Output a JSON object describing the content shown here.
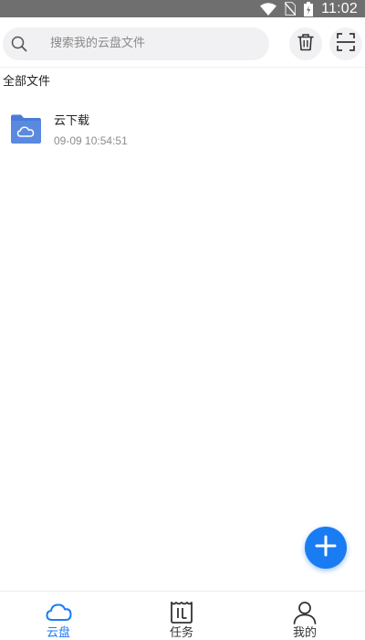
{
  "status_bar": {
    "time": "11:02",
    "icons": [
      "wifi-icon",
      "no-sim-icon",
      "battery-charging-icon"
    ]
  },
  "search": {
    "placeholder": "搜索我的云盘文件",
    "icon": "search-icon"
  },
  "toolbar": {
    "trash_icon": "trash-icon",
    "scan_icon": "scan-icon"
  },
  "breadcrumb": {
    "label": "全部文件"
  },
  "files": [
    {
      "name": "云下载",
      "time": "09-09 10:54:51",
      "icon": "cloud-folder-icon"
    }
  ],
  "fab": {
    "icon": "plus-icon"
  },
  "bottom_nav": {
    "items": [
      {
        "label": "云盘",
        "icon": "cloud-icon",
        "active": true
      },
      {
        "label": "任务",
        "icon": "task-icon",
        "active": false
      },
      {
        "label": "我的",
        "icon": "user-icon",
        "active": false
      }
    ]
  },
  "colors": {
    "accent": "#1a7cf2",
    "folder": "#4a7bd8",
    "status_bar": "#6f6f6f"
  }
}
